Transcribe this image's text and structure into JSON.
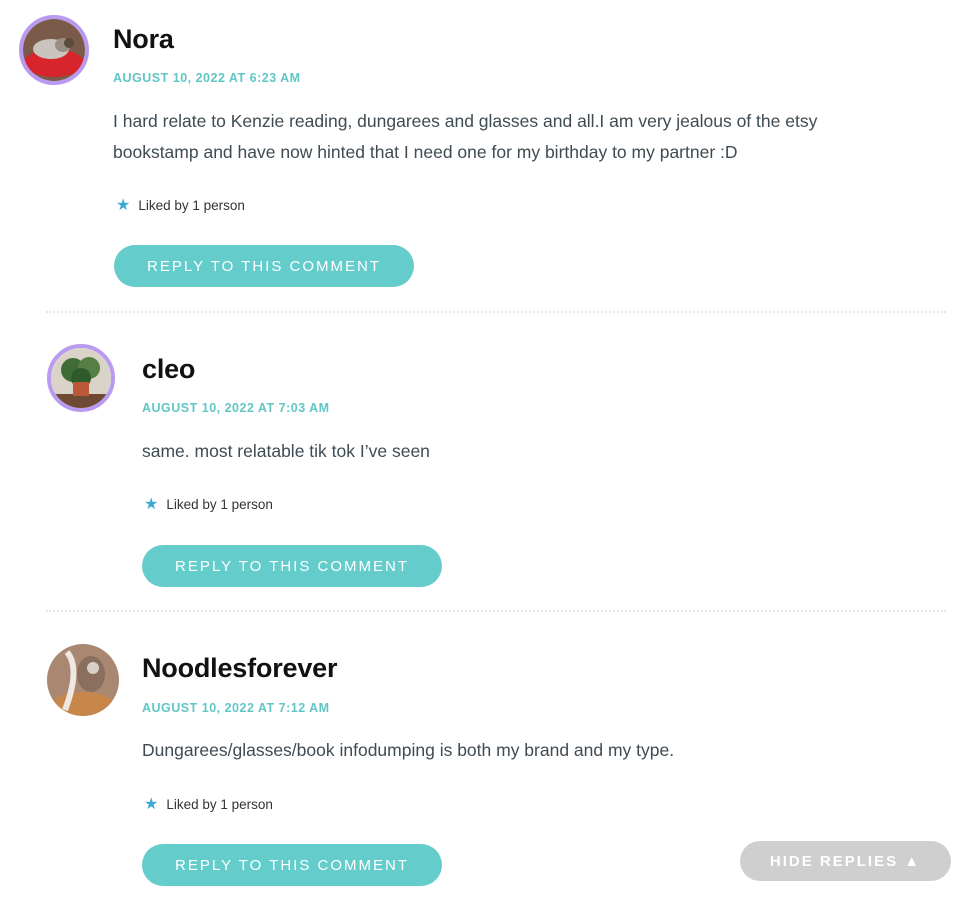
{
  "comments": [
    {
      "author": "Nora",
      "date": "AUGUST 10, 2022 AT 6:23 AM",
      "text": "I hard relate to Kenzie reading, dungarees and glasses and all.I am very jealous of the etsy bookstamp and have now hinted that I need one for my birthday to my partner :D",
      "likes": "Liked by 1 person",
      "reply_label": "REPLY TO THIS COMMENT"
    },
    {
      "author": "cleo",
      "date": "AUGUST 10, 2022 AT 7:03 AM",
      "text": "same. most relatable tik tok I’ve seen",
      "likes": "Liked by 1 person",
      "reply_label": "REPLY TO THIS COMMENT"
    },
    {
      "author": "Noodlesforever",
      "date": "AUGUST 10, 2022 AT 7:12 AM",
      "text": "Dungarees/glasses/book infodumping is both my brand and my type.",
      "likes": "Liked by 1 person",
      "reply_label": "REPLY TO THIS COMMENT"
    }
  ],
  "hide_replies_label": "HIDE REPLIES ▲",
  "colors": {
    "accent": "#64cccb",
    "date": "#62c6c6",
    "avatar_ring": "#b89af0",
    "star": "#3fa9d6",
    "hide_button": "#cfcfcf"
  },
  "icons": {
    "like": "star-icon"
  }
}
